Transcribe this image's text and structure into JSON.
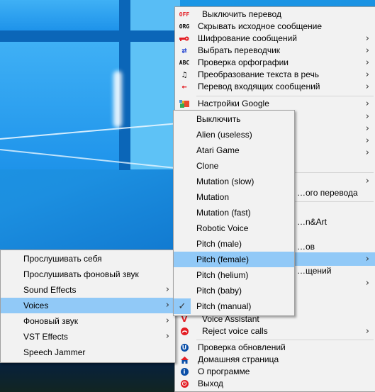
{
  "main_menu": {
    "items": [
      {
        "label": "Выключить перевод",
        "icon": "off-icon",
        "icon_text": "OFF",
        "submenu": false
      },
      {
        "label": "Скрывать исходное сообщение",
        "icon": "org-icon",
        "icon_text": "ORG",
        "submenu": false
      },
      {
        "label": "Шифрование сообщений",
        "icon": "key-icon",
        "submenu": true
      },
      {
        "label": "Выбрать переводчик",
        "icon": "swap-arrows-icon",
        "icon_text": "⇄",
        "submenu": true
      },
      {
        "label": "Проверка орфографии",
        "icon": "abc-icon",
        "icon_text": "ABC",
        "submenu": true
      },
      {
        "label": "Преобразование текста в речь",
        "icon": "music-note-icon",
        "icon_text": "♫",
        "submenu": true
      },
      {
        "label": "Перевод входящих сообщений",
        "icon": "left-arrow-icon",
        "icon_text": "←",
        "submenu": true
      },
      {
        "label": "Настройки Google",
        "icon": "google-icon",
        "submenu": true
      },
      {
        "label": "",
        "submenu": true
      },
      {
        "label": "",
        "submenu": true
      },
      {
        "label": "",
        "submenu": true
      },
      {
        "label": "",
        "submenu": true
      },
      {
        "label": "",
        "submenu": true
      },
      {
        "label": "…ого перевода",
        "submenu": false
      },
      {
        "label": "…n&Art",
        "submenu": false
      },
      {
        "label": "…ов",
        "submenu": false
      },
      {
        "label": "",
        "submenu": true,
        "highlighted": true
      },
      {
        "label": "…щений",
        "submenu": false
      },
      {
        "label": "",
        "submenu": true
      },
      {
        "label": "Voice Assistant",
        "icon": "voice-assistant-icon",
        "icon_text": "V",
        "submenu": false
      },
      {
        "label": "Reject voice calls",
        "icon": "reject-call-icon",
        "submenu": true
      },
      {
        "label": "Проверка обновлений",
        "icon": "update-icon",
        "icon_text": "U",
        "submenu": false
      },
      {
        "label": "Домашняя страница",
        "icon": "home-icon",
        "submenu": false
      },
      {
        "label": "О программе",
        "icon": "info-icon",
        "icon_text": "i",
        "submenu": false
      },
      {
        "label": "Выход",
        "icon": "power-icon",
        "icon_text": "⏻",
        "submenu": false
      }
    ]
  },
  "voices_menu": {
    "items": [
      {
        "label": "Выключить"
      },
      {
        "label": "Alien (useless)"
      },
      {
        "label": "Atari Game"
      },
      {
        "label": "Clone"
      },
      {
        "label": "Mutation (slow)"
      },
      {
        "label": "Mutation"
      },
      {
        "label": "Mutation (fast)"
      },
      {
        "label": "Robotic Voice"
      },
      {
        "label": "Pitch (male)"
      },
      {
        "label": "Pitch (female)",
        "highlighted": true
      },
      {
        "label": "Pitch (helium)"
      },
      {
        "label": "Pitch (baby)"
      },
      {
        "label": "Pitch (manual)",
        "checked": true
      }
    ],
    "check_glyph": "✓"
  },
  "audio_menu": {
    "items": [
      {
        "label": "Прослушивать себя",
        "submenu": false
      },
      {
        "label": "Прослушивать фоновый звук",
        "submenu": false
      },
      {
        "label": "Sound Effects",
        "submenu": true
      },
      {
        "label": "Voices",
        "submenu": true,
        "highlighted": true
      },
      {
        "label": "Фоновый звук",
        "submenu": true
      },
      {
        "label": "VST Effects",
        "submenu": true
      },
      {
        "label": "Speech Jammer",
        "submenu": false
      }
    ]
  },
  "arrow_glyph": "›",
  "colors": {
    "menu_bg": "#f2f2f2",
    "highlight": "#91c9f7",
    "icon_red": "#e31e24",
    "icon_blue": "#0b4fa8"
  }
}
